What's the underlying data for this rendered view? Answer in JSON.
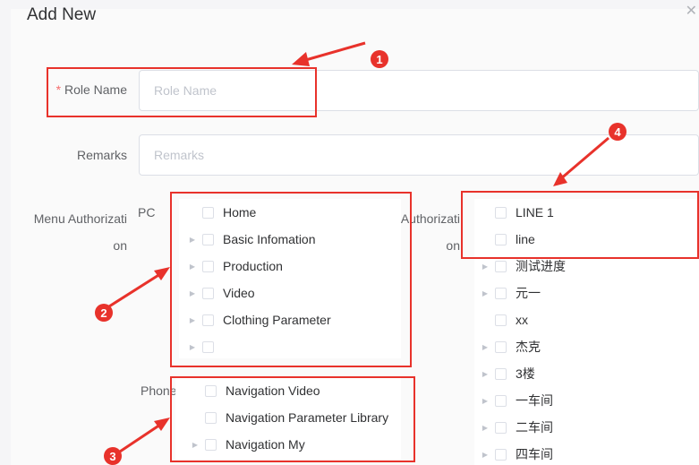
{
  "dialog": {
    "title": "Add New",
    "close_icon": "close-icon"
  },
  "form": {
    "role_name": {
      "label": "Role Name",
      "required_mark": "*",
      "placeholder": "Role Name"
    },
    "remarks": {
      "label": "Remarks",
      "placeholder": "Remarks"
    },
    "menu_auth": {
      "label_line1": "Menu Authorizati",
      "label_line2": "on"
    },
    "auth": {
      "label_line1": "Authorizati",
      "label_line2": "on"
    }
  },
  "pc": {
    "label": "PC",
    "items": [
      {
        "label": "Home",
        "expandable": false
      },
      {
        "label": "Basic Infomation",
        "expandable": true
      },
      {
        "label": "Production",
        "expandable": true
      },
      {
        "label": "Video",
        "expandable": true
      },
      {
        "label": "Clothing Parameter",
        "expandable": true
      },
      {
        "label": "",
        "expandable": true
      }
    ]
  },
  "phone": {
    "label": "Phone",
    "items": [
      {
        "label": "Navigation Video",
        "expandable": false
      },
      {
        "label": "Navigation Parameter Library",
        "expandable": false
      },
      {
        "label": "Navigation My",
        "expandable": true
      }
    ]
  },
  "lines": {
    "items": [
      {
        "label": "LINE 1",
        "expandable": false
      },
      {
        "label": "line",
        "expandable": false
      },
      {
        "label": "测试进度",
        "expandable": true
      },
      {
        "label": "元一",
        "expandable": true
      },
      {
        "label": "xx",
        "expandable": false
      },
      {
        "label": "杰克",
        "expandable": true
      },
      {
        "label": "3楼",
        "expandable": true
      },
      {
        "label": "一车间",
        "expandable": true
      },
      {
        "label": "二车间",
        "expandable": true
      },
      {
        "label": "四车间",
        "expandable": true
      }
    ]
  },
  "annotations": {
    "badges": [
      "1",
      "2",
      "3",
      "4"
    ],
    "accent_color": "#e8322b"
  }
}
